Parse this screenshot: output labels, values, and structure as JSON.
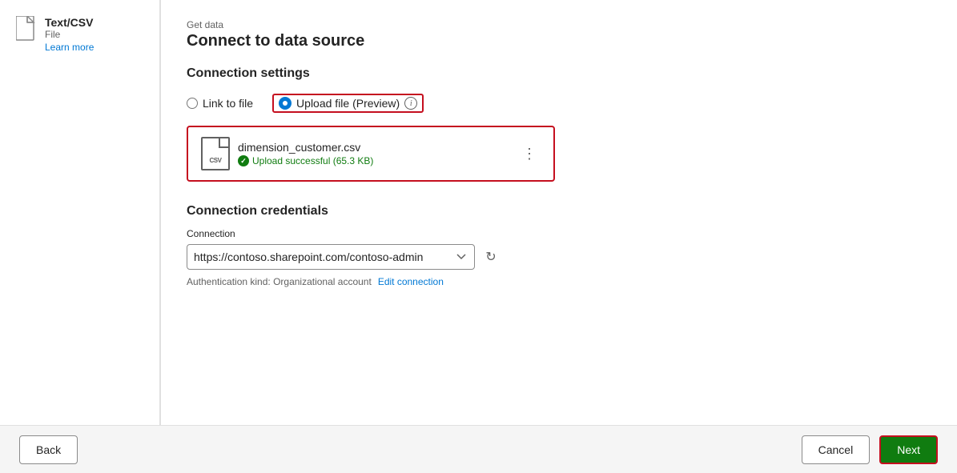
{
  "header": {
    "supertitle": "Get data",
    "title": "Connect to data source"
  },
  "sidebar": {
    "file_type": "Text/CSV",
    "file_label": "File",
    "learn_more_label": "Learn more"
  },
  "connection_settings": {
    "section_title": "Connection settings",
    "option_link": "Link to file",
    "option_upload": "Upload file (Preview)",
    "info_icon_label": "ℹ",
    "file_name": "dimension_customer.csv",
    "upload_status": "Upload successful (65.3 KB)",
    "more_options_label": "⋮"
  },
  "credentials": {
    "section_title": "Connection credentials",
    "connection_label": "Connection",
    "connection_value": "https://contoso.sharepoint.com/contoso-admin",
    "auth_kind_label": "Authentication kind: Organizational account",
    "edit_connection_label": "Edit connection"
  },
  "footer": {
    "back_label": "Back",
    "cancel_label": "Cancel",
    "next_label": "Next"
  }
}
